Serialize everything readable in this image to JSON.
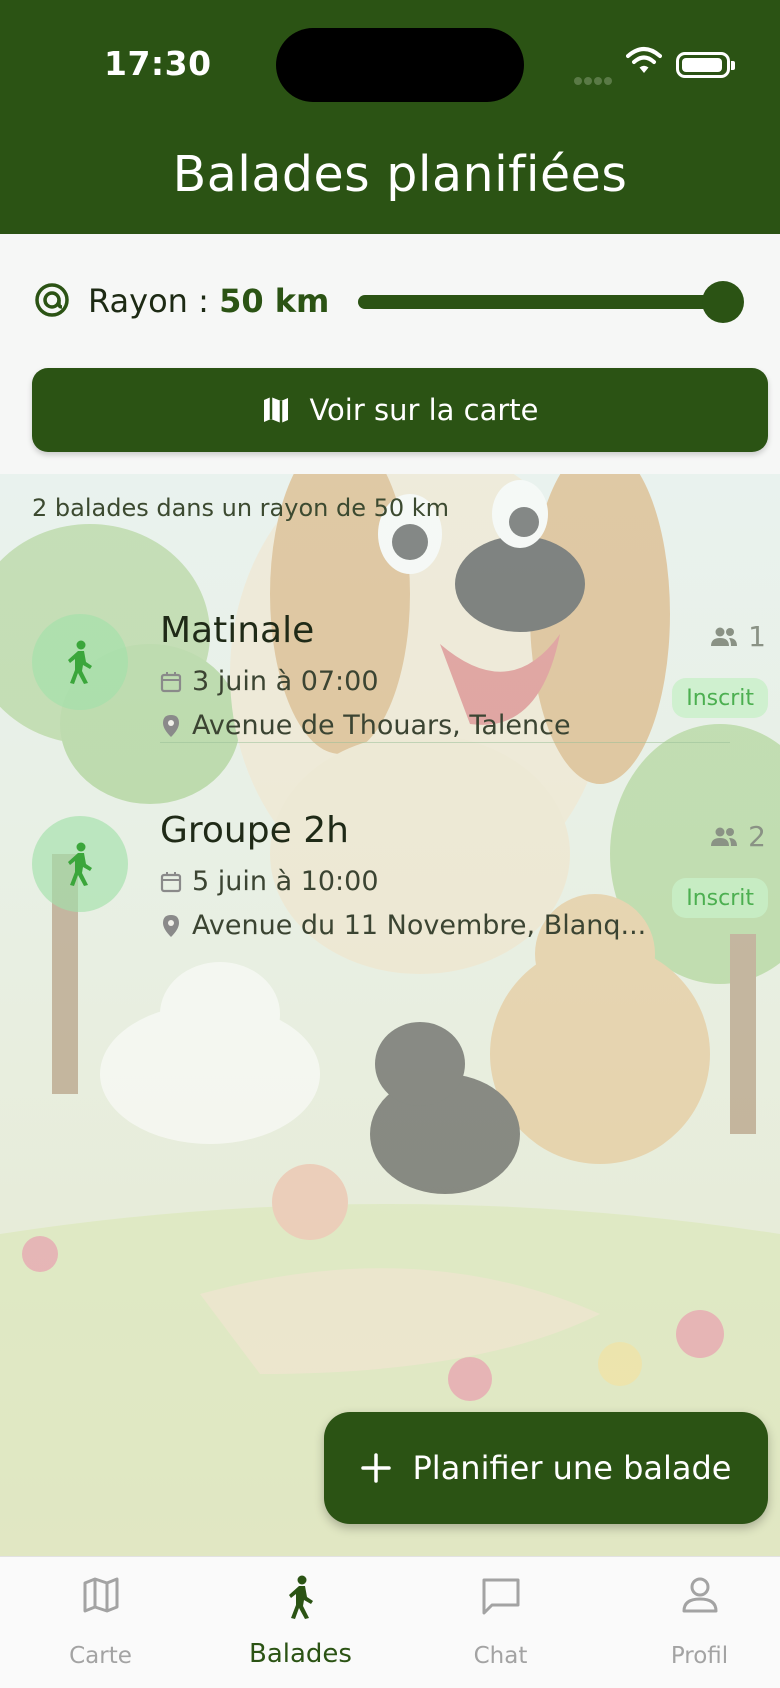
{
  "status_bar": {
    "time": "17:30"
  },
  "header": {
    "title": "Balades planifiées"
  },
  "radius": {
    "label_prefix": "Rayon :",
    "value": "50 km",
    "slider_fraction": 1.0
  },
  "map_button": {
    "label": "Voir sur la carte"
  },
  "results": {
    "count_text": "2 balades dans un rayon de 50 km",
    "walks": [
      {
        "title": "Matinale",
        "date": "3 juin à 07:00",
        "location": "Avenue de Thouars, Talence",
        "participants": "1",
        "status": "Inscrit"
      },
      {
        "title": "Groupe 2h",
        "date": "5 juin à 10:00",
        "location": "Avenue du 11 Novembre, Blanq...",
        "participants": "2",
        "status": "Inscrit"
      }
    ]
  },
  "fab": {
    "label": "Planifier une balade"
  },
  "nav": {
    "items": [
      {
        "label": "Carte",
        "icon": "map-icon"
      },
      {
        "label": "Balades",
        "icon": "walk-icon",
        "active": true
      },
      {
        "label": "Chat",
        "icon": "chat-icon"
      },
      {
        "label": "Profil",
        "icon": "profile-icon"
      }
    ]
  },
  "colors": {
    "primary": "#2b5314",
    "badge_text": "#4caf50",
    "badge_bg": "#c8f0c8",
    "inactive_nav": "#a3a3a3"
  }
}
